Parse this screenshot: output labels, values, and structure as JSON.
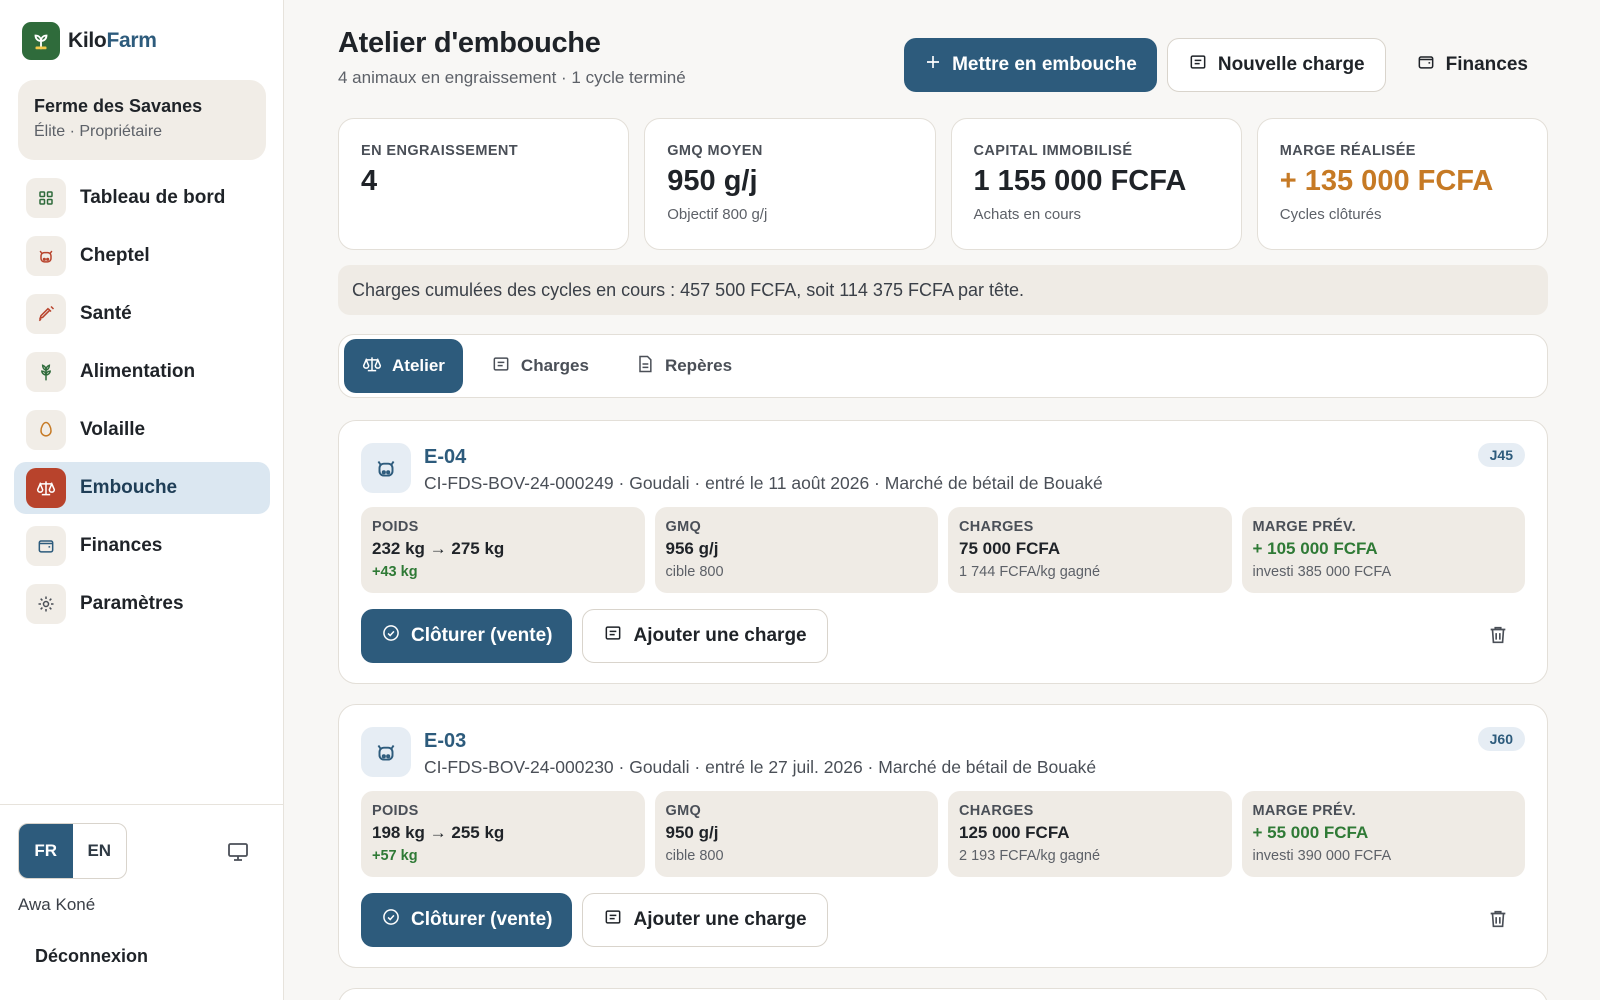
{
  "brand": {
    "name_part1": "Kilo",
    "name_part2": "Farm"
  },
  "farm": {
    "name": "Ferme des Savanes",
    "role": "Élite · Propriétaire"
  },
  "nav": [
    {
      "label": "Tableau de bord",
      "icon": "grid-icon"
    },
    {
      "label": "Cheptel",
      "icon": "cow-icon"
    },
    {
      "label": "Santé",
      "icon": "syringe-icon"
    },
    {
      "label": "Alimentation",
      "icon": "wheat-icon"
    },
    {
      "label": "Volaille",
      "icon": "egg-icon"
    },
    {
      "label": "Embouche",
      "icon": "scale-icon",
      "active": true
    },
    {
      "label": "Finances",
      "icon": "wallet-icon"
    },
    {
      "label": "Paramètres",
      "icon": "gear-icon"
    }
  ],
  "footer": {
    "lang_fr": "FR",
    "lang_en": "EN",
    "user": "Awa Koné",
    "logout": "Déconnexion"
  },
  "header": {
    "title": "Atelier d'embouche",
    "subtitle": "4 animaux en engraissement · 1 cycle terminé",
    "btn_primary": "Mettre en embouche",
    "btn_charge": "Nouvelle charge",
    "btn_finances": "Finances"
  },
  "stats": [
    {
      "label": "EN ENGRAISSEMENT",
      "value": "4",
      "note": ""
    },
    {
      "label": "GMQ MOYEN",
      "value": "950 g/j",
      "note": "Objectif 800 g/j"
    },
    {
      "label": "CAPITAL IMMOBILISÉ",
      "value": "1 155 000 FCFA",
      "note": "Achats en cours"
    },
    {
      "label": "MARGE RÉALISÉE",
      "value": "+ 135 000 FCFA",
      "note": "Cycles clôturés"
    }
  ],
  "notice": "Charges cumulées des cycles en cours : 457 500 FCFA, soit 114 375 FCFA par tête.",
  "tabs": [
    {
      "label": "Atelier",
      "active": true
    },
    {
      "label": "Charges"
    },
    {
      "label": "Repères"
    }
  ],
  "cards": [
    {
      "id": "E-04",
      "meta": "CI-FDS-BOV-24-000249 · Goudali · entré le 11 août 2026 · Marché de bétail de Bouaké",
      "badge": "J45",
      "metrics": [
        {
          "label": "POIDS",
          "value": "232 kg → 275 kg",
          "note": "+43 kg"
        },
        {
          "label": "GMQ",
          "value": "956 g/j",
          "note": "cible 800"
        },
        {
          "label": "CHARGES",
          "value": "75 000 FCFA",
          "note": "1 744 FCFA/kg gagné"
        },
        {
          "label": "MARGE PRÉV.",
          "value": "+ 105 000 FCFA",
          "note": "investi 385 000 FCFA"
        }
      ],
      "btn_close": "Clôturer (vente)",
      "btn_add": "Ajouter une charge"
    },
    {
      "id": "E-03",
      "meta": "CI-FDS-BOV-24-000230 · Goudali · entré le 27 juil. 2026 · Marché de bétail de Bouaké",
      "badge": "J60",
      "metrics": [
        {
          "label": "POIDS",
          "value": "198 kg → 255 kg",
          "note": "+57 kg"
        },
        {
          "label": "GMQ",
          "value": "950 g/j",
          "note": "cible 800"
        },
        {
          "label": "CHARGES",
          "value": "125 000 FCFA",
          "note": "2 193 FCFA/kg gagné"
        },
        {
          "label": "MARGE PRÉV.",
          "value": "+ 55 000 FCFA",
          "note": "investi 390 000 FCFA"
        }
      ],
      "btn_close": "Clôturer (vente)",
      "btn_add": "Ajouter une charge"
    }
  ],
  "colors": {
    "primary": "#2d5b7c",
    "brand_green": "#2f6b3b",
    "active_icon": "#b8432c",
    "positive": "#2f7a36",
    "orange": "#c67a25"
  }
}
